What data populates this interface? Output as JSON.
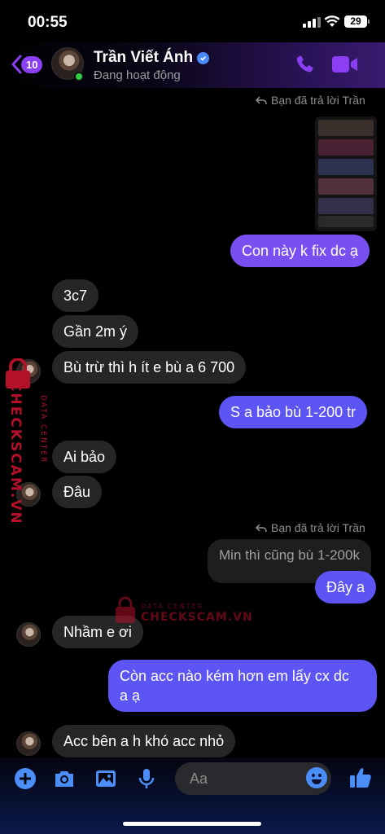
{
  "status_bar": {
    "time": "00:55",
    "battery": "29"
  },
  "header": {
    "back_badge": "10",
    "contact_name": "Trần Viết Ánh",
    "presence": "Đang hoạt động"
  },
  "messages": {
    "reply_label_1": "Bạn đã trả lời Trần",
    "out_1": "Con này k fix dc ạ",
    "in_1": "3c7",
    "in_2": "Gần 2m ý",
    "in_3": "Bù trừ thì h ít e bù a 6 700",
    "out_2": "S a bảo bù 1-200 tr",
    "in_4": "Ai bảo",
    "in_5": "Đâu",
    "reply_label_2": "Bạn đã trả lời Trần",
    "quoted_2": "Min thì cũng bù 1-200k",
    "out_3": "Đây a",
    "in_6": "Nhầm e ơi",
    "out_4_line1": "Còn acc nào kém hơn em lấy cx dc",
    "out_4_line2": "a ạ",
    "in_7": "Acc bên a h khó acc nhỏ"
  },
  "watermark": {
    "side_brand": "CHECKSCAM.VN",
    "side_tag": "DATA CENTER",
    "center_tag": "DATA CENTER",
    "center_brand": "CHECKSCAM.VN"
  },
  "composer": {
    "placeholder": "Aa"
  },
  "colors": {
    "accent": "#8a3ff2",
    "outgoing": "#5d54f4",
    "incoming": "#262626",
    "icon_blue": "#4b8ef7"
  }
}
